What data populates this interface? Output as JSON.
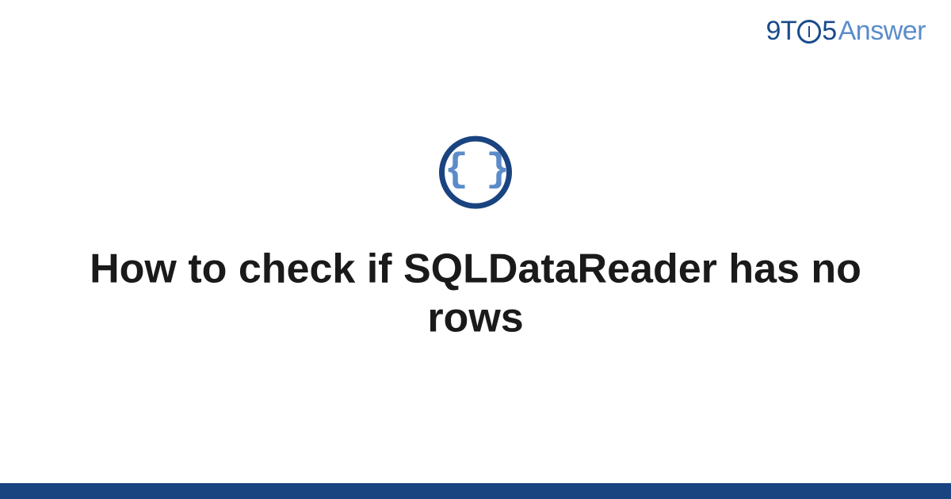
{
  "logo": {
    "part1": "9",
    "part2": "T",
    "part3": "5",
    "part4": "Answer"
  },
  "icon": {
    "braces": "{ }"
  },
  "title": "How to check if SQLDataReader has no rows",
  "colors": {
    "dark_blue": "#1a4480",
    "light_blue": "#5b8cc9",
    "text": "#1a1a1a"
  }
}
